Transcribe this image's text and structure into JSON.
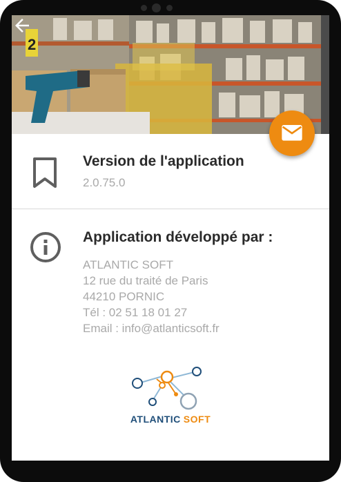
{
  "colors": {
    "accent": "#ee8b11",
    "title_text": "#2a2a2a",
    "secondary_text": "#a9a9a9",
    "icon": "#5f5f5f",
    "logo_blue": "#1f4e79",
    "logo_orange": "#ee8b11"
  },
  "header": {
    "back_icon": "arrow-left-icon",
    "fab_icon": "mail-icon"
  },
  "version": {
    "icon": "bookmark-icon",
    "title": "Version de l'application",
    "value": "2.0.75.0"
  },
  "developer": {
    "icon": "info-icon",
    "title": "Application développé par :",
    "lines": [
      "ATLANTIC SOFT",
      "12 rue du traité de Paris",
      "44210 PORNIC",
      "Tél : 02 51 18 01 27",
      "Email : info@atlanticsoft.fr"
    ]
  },
  "logo": {
    "word1": "ATLANTIC",
    "word2": "SOFT"
  }
}
